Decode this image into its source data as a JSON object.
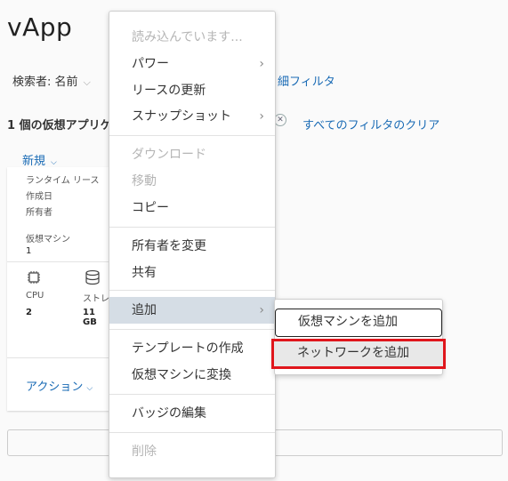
{
  "page": {
    "title": "vApp"
  },
  "search": {
    "by_label": "検索者: 名前",
    "filter_link": "細フィルタ"
  },
  "results": {
    "count": "1 個の仮想アプリケ",
    "clear_filters": "すべてのフィルタのクリア"
  },
  "toolbar": {
    "new_label": "新規"
  },
  "card": {
    "runtime_lease_label": "ランタイム リース",
    "created_label": "作成日",
    "owner_label": "所有者",
    "vms_label": "仮想マシン",
    "vms_value": "1",
    "cpu_label": "CPU",
    "cpu_value": "2",
    "storage_label": "ストレ",
    "storage_value": "11 GB",
    "action_label": "アクション"
  },
  "context_menu": {
    "items": [
      {
        "label": "読み込んでいます...",
        "disabled": true
      },
      {
        "label": "パワー",
        "submenu": true
      },
      {
        "label": "リースの更新"
      },
      {
        "label": "スナップショット",
        "submenu": true
      },
      {
        "label": "ダウンロード",
        "disabled": true
      },
      {
        "label": "移動",
        "disabled": true
      },
      {
        "label": "コピー"
      },
      {
        "label": "所有者を変更"
      },
      {
        "label": "共有"
      },
      {
        "label": "追加",
        "submenu": true,
        "active": true
      },
      {
        "label": "テンプレートの作成"
      },
      {
        "label": "仮想マシンに変換"
      },
      {
        "label": "バッジの編集"
      },
      {
        "label": "削除",
        "disabled": true
      }
    ]
  },
  "submenu": {
    "items": [
      {
        "label": "仮想マシンを追加"
      },
      {
        "label": "ネットワークを追加"
      }
    ]
  },
  "colors": {
    "link": "#1a6bb5",
    "highlight": "#e0161c",
    "active_bg": "#d5dde5"
  }
}
